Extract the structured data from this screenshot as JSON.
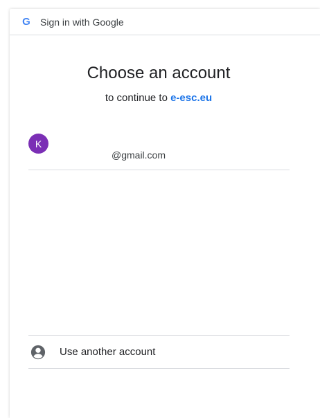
{
  "titlebar": {
    "logo": "G",
    "title": "Sign in with Google"
  },
  "main": {
    "heading": "Choose an account",
    "subheading_prefix": "to continue to ",
    "subheading_link": "e-esc.eu"
  },
  "account": {
    "avatar_letter": "K",
    "avatar_color": "#7b2fb5",
    "email": "@gmail.com"
  },
  "another": {
    "label": "Use another account",
    "icon": "account-circle-icon"
  },
  "colors": {
    "google_blue": "#4285f4",
    "link_blue": "#1a73e8",
    "divider": "#dadce0"
  }
}
